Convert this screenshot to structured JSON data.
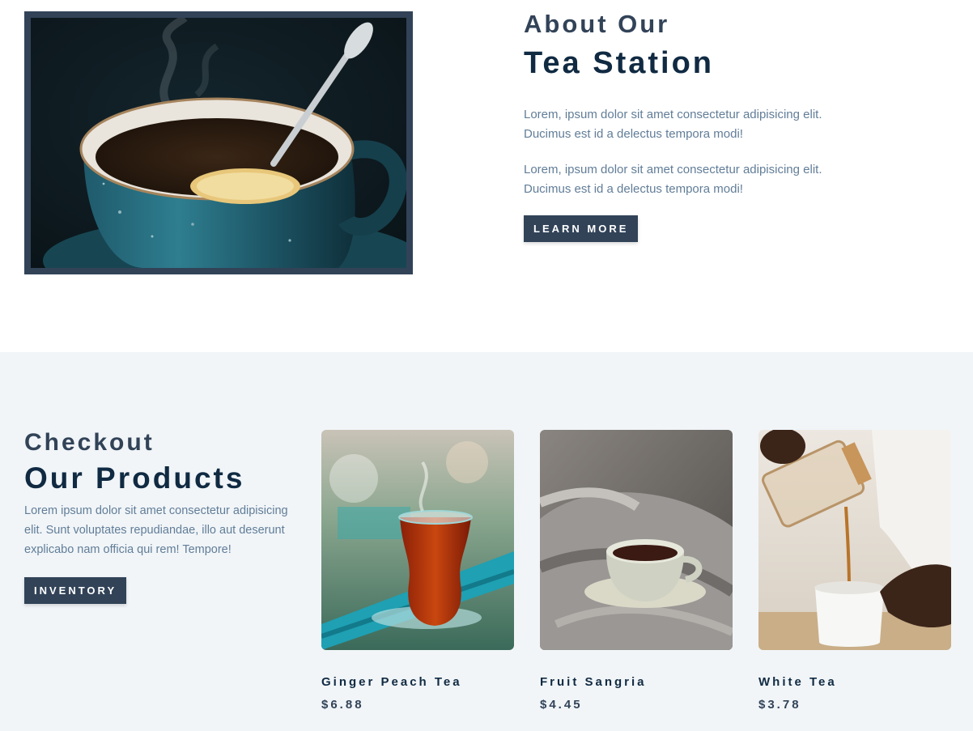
{
  "about": {
    "subtitle": "About Our",
    "title": "Tea Station",
    "paragraphs": [
      "Lorem, ipsum dolor sit amet consectetur adipisicing elit. Ducimus est id a delectus tempora modi!",
      "Lorem, ipsum dolor sit amet consectetur adipisicing elit. Ducimus est id a delectus tempora modi!"
    ],
    "button_label": "Learn More"
  },
  "products": {
    "subtitle": "Checkout",
    "title": "Our Products",
    "description": "Lorem ipsum dolor sit amet consectetur adipisicing elit. Sunt voluptates repudiandae, illo aut deserunt explicabo nam officia qui rem! Tempore!",
    "button_label": "Inventory",
    "items": [
      {
        "name": "Ginger Peach Tea",
        "price": "$6.88"
      },
      {
        "name": "Fruit Sangria",
        "price": "$4.45"
      },
      {
        "name": "White Tea",
        "price": "$3.78"
      }
    ]
  },
  "colors": {
    "primary_dark": "#102a42",
    "accent": "#324358",
    "body_text": "#617d98",
    "section_bg": "#f1f5f8"
  }
}
